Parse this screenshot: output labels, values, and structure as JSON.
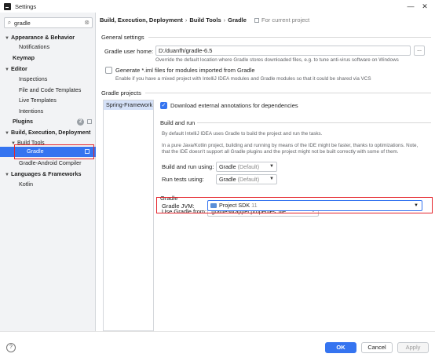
{
  "window": {
    "title": "Settings",
    "minimize": "—",
    "close": "✕"
  },
  "search": {
    "value": "gradle",
    "placeholder": ""
  },
  "sidebar": {
    "items": [
      {
        "label": "Appearance & Behavior"
      },
      {
        "label": "Notifications"
      },
      {
        "label": "Keymap"
      },
      {
        "label": "Editor"
      },
      {
        "label": "Inspections"
      },
      {
        "label": "File and Code Templates"
      },
      {
        "label": "Live Templates"
      },
      {
        "label": "Intentions"
      },
      {
        "label": "Plugins",
        "badge": "2"
      },
      {
        "label": "Build, Execution, Deployment"
      },
      {
        "label": "Build Tools"
      },
      {
        "label": "Gradle"
      },
      {
        "label": "Gradle-Android Compiler"
      },
      {
        "label": "Languages & Frameworks"
      },
      {
        "label": "Kotlin"
      }
    ]
  },
  "breadcrumb": {
    "part1": "Build, Execution, Deployment",
    "part2": "Build Tools",
    "part3": "Gradle",
    "scope": "For current project"
  },
  "general": {
    "title": "General settings",
    "user_home_label": "Gradle user home:",
    "user_home_value": "D:/duanfh/gradle-6.5",
    "user_home_hint": "Override the default location where Gradle stores downloaded files, e.g. to tune anti-virus software on Windows",
    "browse": "...",
    "iml_label": "Generate *.iml files for modules imported from Gradle",
    "iml_hint": "Enable if you have a mixed project with IntelliJ IDEA modules and Gradle modules so that it could be shared via VCS"
  },
  "projects": {
    "title": "Gradle projects",
    "list": [
      "Spring-Framework"
    ],
    "download_annotations": "Download external annotations for dependencies"
  },
  "build_run": {
    "title": "Build and run",
    "hint1": "By default IntelliJ IDEA uses Gradle to build the project and run the tasks.",
    "hint2": "In a pure Java/Kotlin project, building and running by means of the IDE might be faster, thanks to optimizations. Note,",
    "hint3": "that the IDE doesn't support all Gradle plugins and the project might not be built correctly with some of them.",
    "build_label": "Build and run using:",
    "build_value": "Gradle",
    "build_suffix": "(Default)",
    "tests_label": "Run tests using:",
    "tests_value": "Gradle",
    "tests_suffix": "(Default)"
  },
  "gradle": {
    "title": "Gradle",
    "use_from_label": "Use Gradle from:",
    "use_from_value": "'gradle-wrapper.properties' file",
    "jvm_label": "Gradle JVM:",
    "jvm_value": "Project SDK",
    "jvm_version": "11"
  },
  "footer": {
    "help": "?",
    "ok": "OK",
    "cancel": "Cancel",
    "apply": "Apply"
  },
  "colors": {
    "accent": "#3574f0",
    "highlight": "#e5242b"
  }
}
